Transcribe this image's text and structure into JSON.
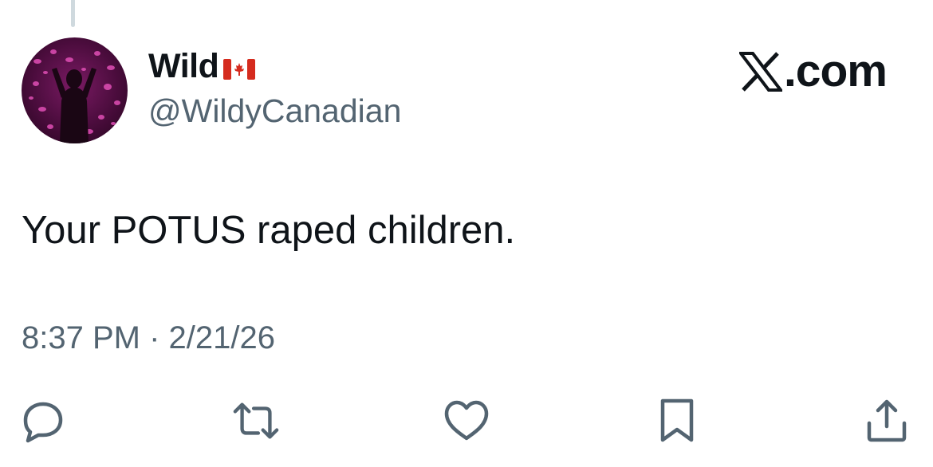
{
  "author": {
    "display_name": "Wild",
    "handle": "@WildyCanadian",
    "avatar_icon": "avatar-image",
    "flag_emoji": "canada-flag"
  },
  "watermark": {
    "logo_icon": "x-logo-icon",
    "text": ".com"
  },
  "tweet": {
    "text": "Your POTUS raped children.",
    "timestamp": "8:37 PM · 2/21/26"
  },
  "actions": [
    {
      "name": "reply",
      "icon": "reply-icon"
    },
    {
      "name": "repost",
      "icon": "repost-icon"
    },
    {
      "name": "like",
      "icon": "like-icon"
    },
    {
      "name": "bookmark",
      "icon": "bookmark-icon"
    },
    {
      "name": "share",
      "icon": "share-icon"
    }
  ],
  "colors": {
    "text_primary": "#0f1419",
    "text_secondary": "#536471",
    "icon_gray": "#536471",
    "thread_line": "#cfd9de",
    "flag_red": "#d52b1e"
  }
}
